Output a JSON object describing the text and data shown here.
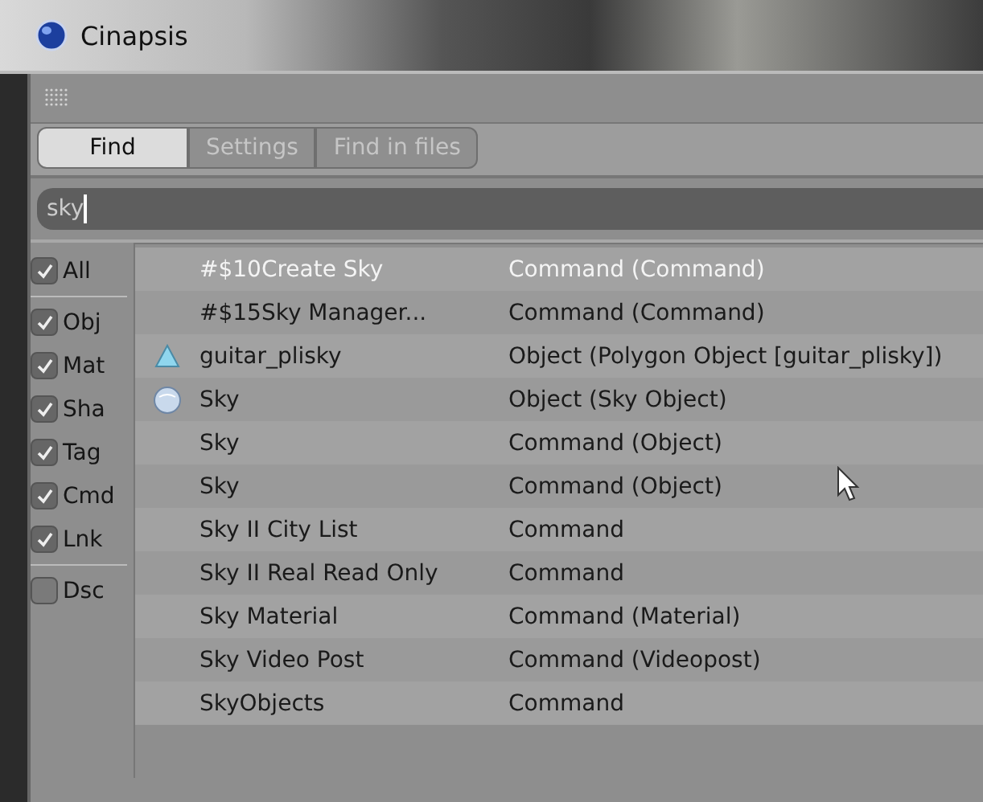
{
  "window": {
    "title": "Cinapsis"
  },
  "tabs": [
    {
      "label": "Find",
      "selected": true
    },
    {
      "label": "Settings",
      "selected": false
    },
    {
      "label": "Find in files",
      "selected": false
    }
  ],
  "search": {
    "value": "sky"
  },
  "filters": [
    {
      "label": "All",
      "checked": true
    },
    {
      "label": "Obj",
      "checked": true
    },
    {
      "label": "Mat",
      "checked": true
    },
    {
      "label": "Sha",
      "checked": true
    },
    {
      "label": "Tag",
      "checked": true
    },
    {
      "label": "Cmd",
      "checked": true
    },
    {
      "label": "Lnk",
      "checked": true
    },
    {
      "label": "Dsc",
      "checked": false
    }
  ],
  "results": [
    {
      "name": "#$10Create Sky",
      "type": "Command (Command)",
      "selected": true,
      "kind": "command"
    },
    {
      "name": "#$15Sky Manager...",
      "type": "Command (Command)",
      "selected": false,
      "kind": "command"
    },
    {
      "name": "guitar_plisky",
      "type": "Object (Polygon Object [guitar_plisky])",
      "selected": false,
      "kind": "polygon"
    },
    {
      "name": "Sky",
      "type": "Object (Sky Object)",
      "selected": false,
      "kind": "sky"
    },
    {
      "name": "Sky",
      "type": "Command (Object)",
      "selected": false,
      "kind": "command"
    },
    {
      "name": "Sky",
      "type": "Command (Object)",
      "selected": false,
      "kind": "command"
    },
    {
      "name": "Sky II City List",
      "type": "Command",
      "selected": false,
      "kind": "command"
    },
    {
      "name": "Sky II Real Read Only",
      "type": "Command",
      "selected": false,
      "kind": "command"
    },
    {
      "name": "Sky Material",
      "type": "Command (Material)",
      "selected": false,
      "kind": "command"
    },
    {
      "name": "Sky Video Post",
      "type": "Command (Videopost)",
      "selected": false,
      "kind": "command"
    },
    {
      "name": "SkyObjects",
      "type": "Command",
      "selected": false,
      "kind": "command"
    }
  ]
}
